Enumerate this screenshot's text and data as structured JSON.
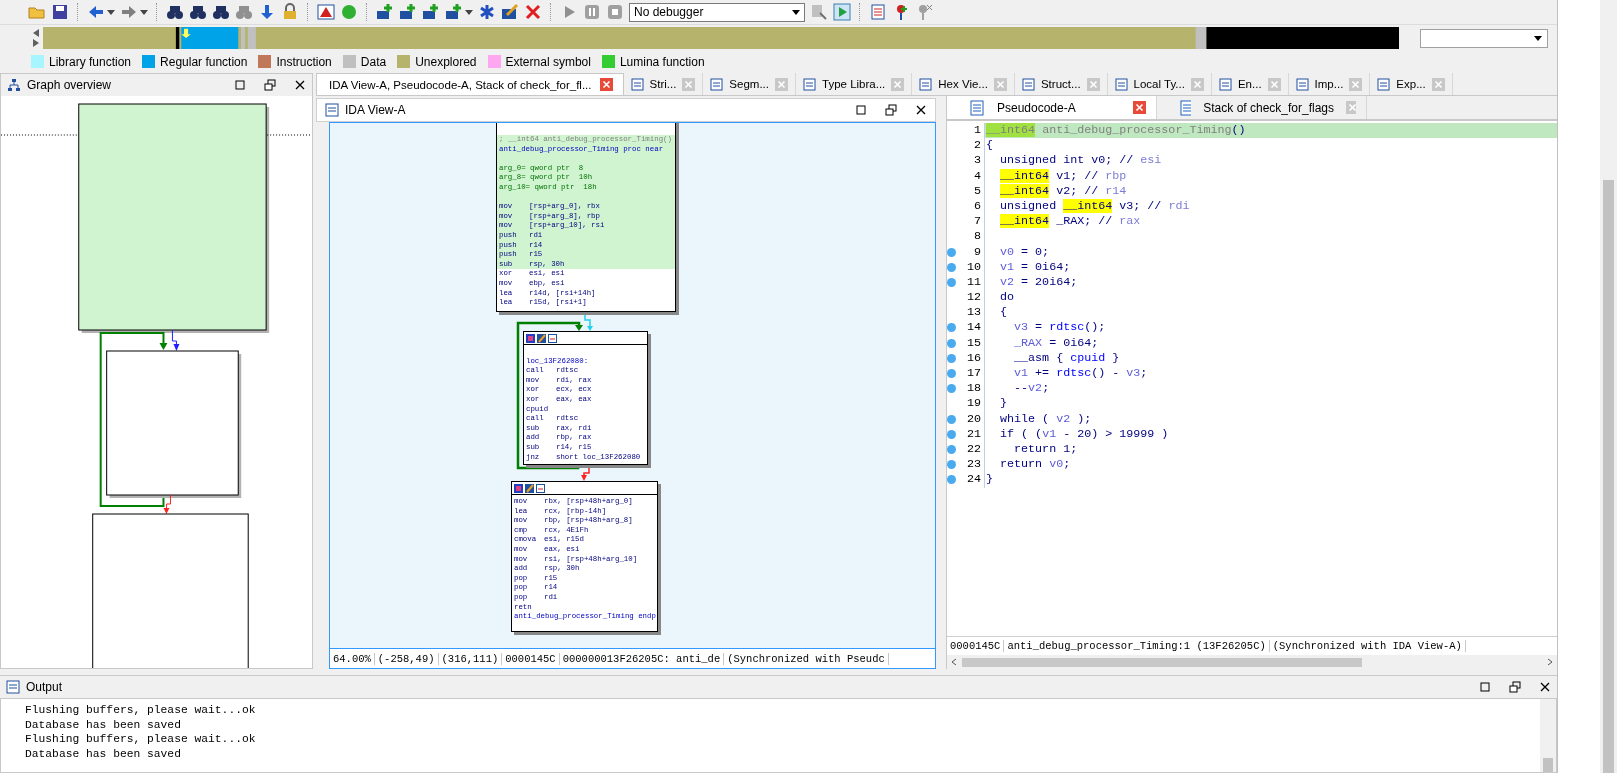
{
  "toolbar": {
    "debugger": "No debugger"
  },
  "legend": [
    {
      "label": "Library function",
      "color": "#a6f5ff"
    },
    {
      "label": "Regular function",
      "color": "#00a2e8"
    },
    {
      "label": "Instruction",
      "color": "#c07858"
    },
    {
      "label": "Data",
      "color": "#c0c0c0"
    },
    {
      "label": "Unexplored",
      "color": "#b5b36c"
    },
    {
      "label": "External symbol",
      "color": "#ffa6f0"
    },
    {
      "label": "Lumina function",
      "color": "#33cc33"
    }
  ],
  "graph_overview": {
    "title": "Graph overview"
  },
  "tabs": [
    {
      "label": "IDA View-A, Pseudocode-A, Stack of check_for_fl...",
      "selected": true
    },
    {
      "label": "Stri...",
      "selected": false
    },
    {
      "label": "Segm...",
      "selected": false
    },
    {
      "label": "Type Libra...",
      "selected": false
    },
    {
      "label": "Hex Vie...",
      "selected": false
    },
    {
      "label": "Struct...",
      "selected": false
    },
    {
      "label": "Local Ty...",
      "selected": false
    },
    {
      "label": "En...",
      "selected": false
    },
    {
      "label": "Imp...",
      "selected": false
    },
    {
      "label": "Exp...",
      "selected": false
    }
  ],
  "ida_view": {
    "title": "IDA View-A",
    "nodes": [
      {
        "header_icons": false,
        "lines": [
          {
            "kind": "comment",
            "text": "; __int64 anti_debug_processor_Timing()",
            "highlighted": true
          },
          {
            "kind": "label",
            "text": "anti_debug_processor_Timing proc near",
            "highlighted": true
          },
          {
            "kind": "blank",
            "highlighted": true
          },
          {
            "kind": "def",
            "text": "arg_0= qword ptr  8",
            "highlighted": true
          },
          {
            "kind": "def",
            "text": "arg_8= qword ptr  10h",
            "highlighted": true
          },
          {
            "kind": "def",
            "text": "arg_10= qword ptr  18h",
            "highlighted": true
          },
          {
            "kind": "blank",
            "highlighted": true
          },
          {
            "kind": "ins",
            "op": "mov",
            "args": "[rsp+arg_0], rbx",
            "highlighted": true
          },
          {
            "kind": "ins",
            "op": "mov",
            "args": "[rsp+arg_8], rbp",
            "highlighted": true
          },
          {
            "kind": "ins",
            "op": "mov",
            "args": "[rsp+arg_10], rsi",
            "highlighted": true
          },
          {
            "kind": "ins",
            "op": "push",
            "args": "rdi",
            "highlighted": true
          },
          {
            "kind": "ins",
            "op": "push",
            "args": "r14",
            "highlighted": true
          },
          {
            "kind": "ins",
            "op": "push",
            "args": "r15",
            "highlighted": true
          },
          {
            "kind": "ins",
            "op": "sub",
            "args": "rsp, 30h",
            "highlighted": true
          },
          {
            "kind": "ins",
            "op": "xor",
            "args": "esi, esi",
            "highlighted": false
          },
          {
            "kind": "ins",
            "op": "mov",
            "args": "ebp, esi",
            "highlighted": false
          },
          {
            "kind": "ins",
            "op": "lea",
            "args": "r14d, [rsi+14h]",
            "highlighted": false
          },
          {
            "kind": "ins",
            "op": "lea",
            "args": "r15d, [rsi+1]",
            "highlighted": false
          }
        ]
      },
      {
        "header_icons": true,
        "lines": [
          {
            "kind": "blank",
            "highlighted": false
          },
          {
            "kind": "label",
            "text": "loc_13F262080:",
            "highlighted": false
          },
          {
            "kind": "ins",
            "op": "call",
            "args": "rdtsc",
            "highlighted": false
          },
          {
            "kind": "ins",
            "op": "mov",
            "args": "rdi, rax",
            "highlighted": false
          },
          {
            "kind": "ins",
            "op": "xor",
            "args": "ecx, ecx",
            "highlighted": false
          },
          {
            "kind": "ins",
            "op": "xor",
            "args": "eax, eax",
            "highlighted": false
          },
          {
            "kind": "ins",
            "op": "cpuid",
            "highlighted": false
          },
          {
            "kind": "ins",
            "op": "call",
            "args": "rdtsc",
            "highlighted": false
          },
          {
            "kind": "ins",
            "op": "sub",
            "args": "rax, rdi",
            "highlighted": false
          },
          {
            "kind": "ins",
            "op": "add",
            "args": "rbp, rax",
            "highlighted": false
          },
          {
            "kind": "ins",
            "op": "sub",
            "args": "r14, r15",
            "highlighted": false
          },
          {
            "kind": "ins",
            "op": "jnz",
            "args": "short loc_13F262080",
            "highlighted": false
          }
        ]
      },
      {
        "header_icons": true,
        "lines": [
          {
            "kind": "ins",
            "op": "mov",
            "args": "rbx, [rsp+48h+arg_0]",
            "highlighted": false
          },
          {
            "kind": "ins",
            "op": "lea",
            "args": "rcx, [rbp-14h]",
            "highlighted": false
          },
          {
            "kind": "ins",
            "op": "mov",
            "args": "rbp, [rsp+48h+arg_8]",
            "highlighted": false
          },
          {
            "kind": "ins",
            "op": "cmp",
            "args": "rcx, 4E1Fh",
            "highlighted": false
          },
          {
            "kind": "ins",
            "op": "cmova",
            "args": "esi, r15d",
            "highlighted": false
          },
          {
            "kind": "ins",
            "op": "mov",
            "args": "eax, esi",
            "highlighted": false
          },
          {
            "kind": "ins",
            "op": "mov",
            "args": "rsi, [rsp+48h+arg_10]",
            "highlighted": false
          },
          {
            "kind": "ins",
            "op": "add",
            "args": "rsp, 30h",
            "highlighted": false
          },
          {
            "kind": "ins",
            "op": "pop",
            "args": "r15",
            "highlighted": false
          },
          {
            "kind": "ins",
            "op": "pop",
            "args": "r14",
            "highlighted": false
          },
          {
            "kind": "ins",
            "op": "pop",
            "args": "rdi",
            "highlighted": false
          },
          {
            "kind": "ins",
            "op": "retn",
            "highlighted": false
          },
          {
            "kind": "label",
            "text": "anti_debug_processor_Timing endp",
            "highlighted": false
          }
        ]
      }
    ],
    "status": [
      "64.00%",
      "(-258,49)",
      "(316,111)",
      "0000145C",
      "000000013F26205C: anti_de",
      "(Synchronized with Pseudc"
    ]
  },
  "pseudocode": {
    "tabs": [
      {
        "label": "Pseudocode-A",
        "selected": true
      },
      {
        "label": "Stack of check_for_flags",
        "selected": false
      }
    ],
    "lines": [
      {
        "num": "1",
        "marker": false,
        "current": true,
        "tokens": [
          {
            "t": "__int64",
            "kind": "hl"
          },
          {
            "t": " anti_debug_processor_Timing",
            "kind": "dim"
          },
          {
            "t": "()",
            "kind": "plain"
          }
        ]
      },
      {
        "num": "2",
        "marker": false,
        "current": false,
        "tokens": [
          {
            "t": "{",
            "kind": "plain"
          }
        ]
      },
      {
        "num": "3",
        "marker": false,
        "current": false,
        "tokens": [
          {
            "t": "  unsigned int v0; // ",
            "kind": "plain"
          },
          {
            "t": "esi",
            "kind": "reg"
          }
        ]
      },
      {
        "num": "4",
        "marker": false,
        "current": false,
        "tokens": [
          {
            "t": "  __int64",
            "kind": "hl"
          },
          {
            "t": " v1; // ",
            "kind": "plain"
          },
          {
            "t": "rbp",
            "kind": "reg"
          }
        ]
      },
      {
        "num": "5",
        "marker": false,
        "current": false,
        "tokens": [
          {
            "t": "  __int64",
            "kind": "hl"
          },
          {
            "t": " v2; // ",
            "kind": "plain"
          },
          {
            "t": "r14",
            "kind": "reg"
          }
        ]
      },
      {
        "num": "6",
        "marker": false,
        "current": false,
        "tokens": [
          {
            "t": "  unsigned ",
            "kind": "plain"
          },
          {
            "t": "__int64",
            "kind": "hl"
          },
          {
            "t": " v3; // ",
            "kind": "plain"
          },
          {
            "t": "rdi",
            "kind": "reg"
          }
        ]
      },
      {
        "num": "7",
        "marker": false,
        "current": false,
        "tokens": [
          {
            "t": "  __int64",
            "kind": "hl"
          },
          {
            "t": " _RAX; // ",
            "kind": "plain"
          },
          {
            "t": "rax",
            "kind": "reg"
          }
        ]
      },
      {
        "num": "8",
        "marker": false,
        "current": false
      },
      {
        "num": "9",
        "marker": true,
        "current": false,
        "tokens": [
          {
            "t": "  v0",
            "kind": "var"
          },
          {
            "t": " = 0;",
            "kind": "plain"
          }
        ]
      },
      {
        "num": "10",
        "marker": true,
        "current": false,
        "tokens": [
          {
            "t": "  v1",
            "kind": "var"
          },
          {
            "t": " = 0i64;",
            "kind": "plain"
          }
        ]
      },
      {
        "num": "11",
        "marker": true,
        "current": false,
        "tokens": [
          {
            "t": "  v2",
            "kind": "var"
          },
          {
            "t": " = 20i64;",
            "kind": "plain"
          }
        ]
      },
      {
        "num": "12",
        "marker": false,
        "current": false,
        "tokens": [
          {
            "t": "  do",
            "kind": "plain"
          }
        ]
      },
      {
        "num": "13",
        "marker": false,
        "current": false,
        "tokens": [
          {
            "t": "  {",
            "kind": "plain"
          }
        ]
      },
      {
        "num": "14",
        "marker": true,
        "current": false,
        "tokens": [
          {
            "t": "    v3",
            "kind": "var"
          },
          {
            "t": " = ",
            "kind": "plain"
          },
          {
            "t": "rdtsc",
            "kind": "func"
          },
          {
            "t": "();",
            "kind": "plain"
          }
        ]
      },
      {
        "num": "15",
        "marker": true,
        "current": false,
        "tokens": [
          {
            "t": "    _RAX",
            "kind": "var"
          },
          {
            "t": " = 0i64;",
            "kind": "plain"
          }
        ]
      },
      {
        "num": "16",
        "marker": true,
        "current": false,
        "tokens": [
          {
            "t": "    __asm { ",
            "kind": "plain"
          },
          {
            "t": "cpuid",
            "kind": "func"
          },
          {
            "t": " }",
            "kind": "plain"
          }
        ]
      },
      {
        "num": "17",
        "marker": true,
        "current": false,
        "tokens": [
          {
            "t": "    v1",
            "kind": "var"
          },
          {
            "t": " += ",
            "kind": "plain"
          },
          {
            "t": "rdtsc",
            "kind": "func"
          },
          {
            "t": "() - ",
            "kind": "plain"
          },
          {
            "t": "v3",
            "kind": "var"
          },
          {
            "t": ";",
            "kind": "plain"
          }
        ]
      },
      {
        "num": "18",
        "marker": true,
        "current": false,
        "tokens": [
          {
            "t": "    --",
            "kind": "plain"
          },
          {
            "t": "v2",
            "kind": "var"
          },
          {
            "t": ";",
            "kind": "plain"
          }
        ]
      },
      {
        "num": "19",
        "marker": false,
        "current": false,
        "tokens": [
          {
            "t": "  }",
            "kind": "plain"
          }
        ]
      },
      {
        "num": "20",
        "marker": true,
        "current": false,
        "tokens": [
          {
            "t": "  while ( ",
            "kind": "plain"
          },
          {
            "t": "v2",
            "kind": "var"
          },
          {
            "t": " );",
            "kind": "plain"
          }
        ]
      },
      {
        "num": "21",
        "marker": true,
        "current": false,
        "tokens": [
          {
            "t": "  if ( (",
            "kind": "plain"
          },
          {
            "t": "v1",
            "kind": "var"
          },
          {
            "t": " - 20) > 19999 )",
            "kind": "plain"
          }
        ]
      },
      {
        "num": "22",
        "marker": true,
        "current": false,
        "tokens": [
          {
            "t": "    return 1;",
            "kind": "plain"
          }
        ]
      },
      {
        "num": "23",
        "marker": true,
        "current": false,
        "tokens": [
          {
            "t": "  return ",
            "kind": "plain"
          },
          {
            "t": "v0",
            "kind": "var"
          },
          {
            "t": ";",
            "kind": "plain"
          }
        ]
      },
      {
        "num": "24",
        "marker": true,
        "current": false,
        "tokens": [
          {
            "t": "}",
            "kind": "plain"
          }
        ]
      }
    ],
    "status": [
      "0000145C",
      "anti_debug_processor_Timing:1 (13F26205C)",
      "(Synchronized with IDA View-A)"
    ]
  },
  "output": {
    "title": "Output",
    "lines": [
      "Flushing buffers, please wait...ok",
      "Database has been saved",
      "Flushing buffers, please wait...ok",
      "Database has been saved"
    ]
  }
}
